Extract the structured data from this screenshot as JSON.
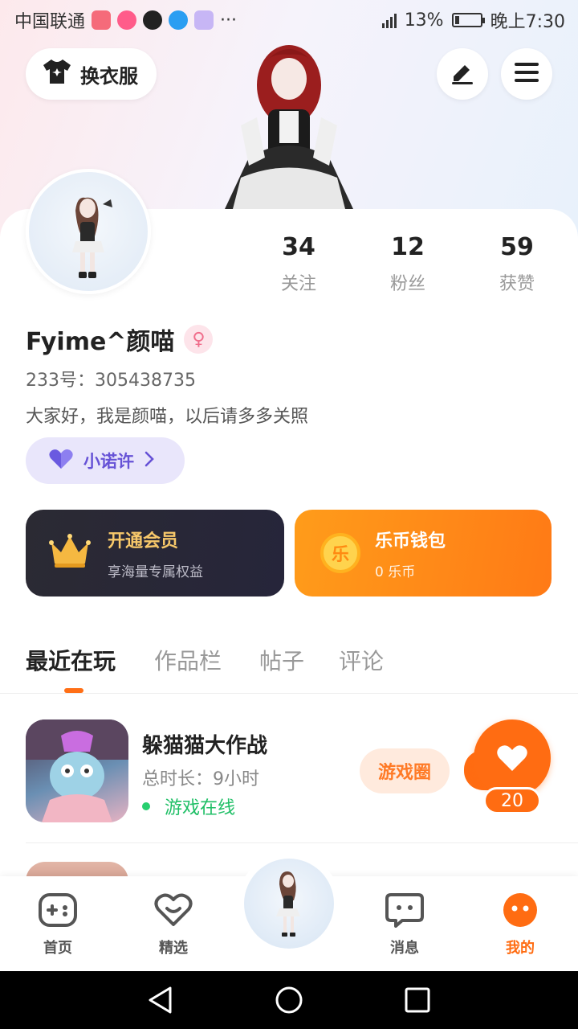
{
  "status_bar": {
    "carrier": "中国联通",
    "battery": "13%",
    "time": "晚上7:30",
    "more": "···"
  },
  "header": {
    "dress_button": "换衣服"
  },
  "profile": {
    "stats": [
      {
        "value": "34",
        "label": "关注"
      },
      {
        "value": "12",
        "label": "粉丝"
      },
      {
        "value": "59",
        "label": "获赞"
      }
    ],
    "name": "Fyime^颜喵",
    "gender_symbol": "♀",
    "uid": "233号：305438735",
    "bio": "大家好，我是颜喵，以后请多多关照",
    "badge": "小诺许"
  },
  "vip_card": {
    "title": "开通会员",
    "subtitle": "享海量专属权益"
  },
  "wallet_card": {
    "title": "乐币钱包",
    "subtitle": "0 乐币",
    "coin_char": "乐"
  },
  "tabs": [
    "最近在玩",
    "作品栏",
    "帖子",
    "评论"
  ],
  "recent_game": {
    "title": "躲猫猫大作战",
    "playtime": "总时长：9小时",
    "status": "游戏在线",
    "circle_button": "游戏圈",
    "likes": "20"
  },
  "bottom_nav": [
    "首页",
    "精选",
    "消息",
    "我的"
  ],
  "colors": {
    "accent": "#ff6c12",
    "online": "#1fbf66",
    "badge": "#6652d6"
  }
}
